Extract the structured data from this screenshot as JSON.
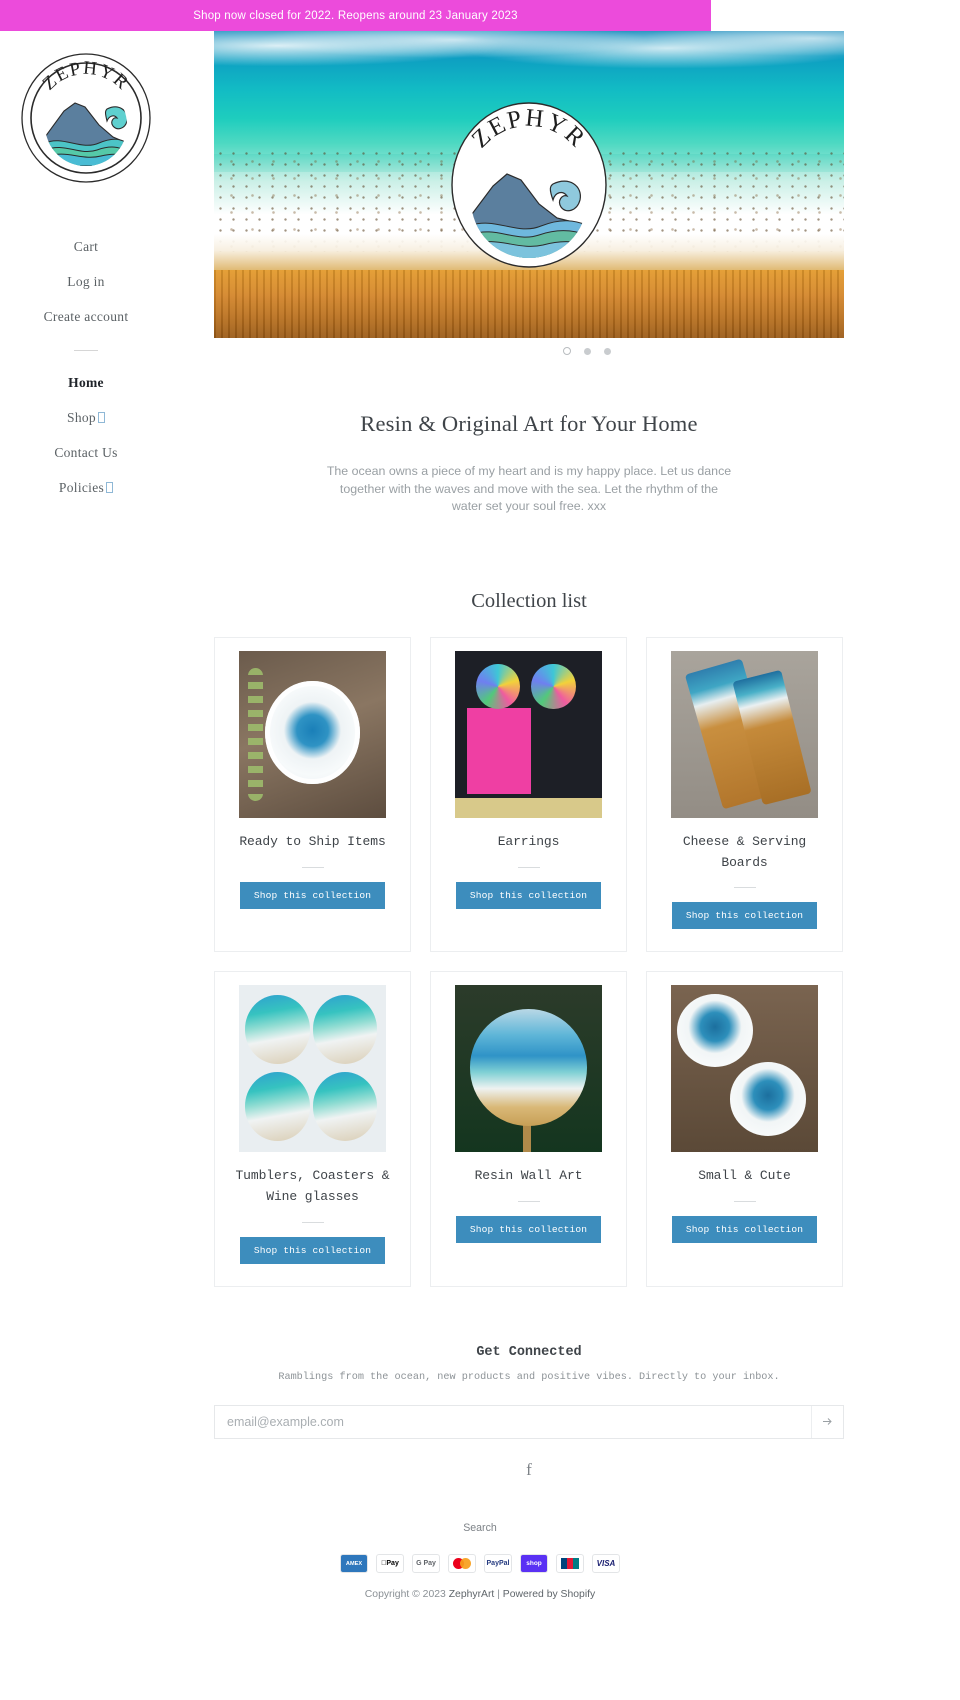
{
  "announcement": {
    "text": "Shop now closed for 2022. Reopens around 23 January 2023",
    "background": "#ec4bdb",
    "color": "#ffffff"
  },
  "brand": {
    "name": "ZEPHYR",
    "logo_alt": "Zephyr circular logo with mountain and waves"
  },
  "sidebar": {
    "account_links": [
      {
        "label": "Cart"
      },
      {
        "label": "Log in"
      },
      {
        "label": "Create account"
      }
    ],
    "main_links": [
      {
        "label": "Home",
        "active": true,
        "has_caret": false
      },
      {
        "label": "Shop",
        "active": false,
        "has_caret": true
      },
      {
        "label": "Contact Us",
        "active": false,
        "has_caret": false
      },
      {
        "label": "Policies",
        "active": false,
        "has_caret": true
      }
    ]
  },
  "hero": {
    "slides_count": 3,
    "active_slide": 1,
    "image_alt": "Resin ocean art with teal water, white foam and wood grain"
  },
  "richtext": {
    "heading": "Resin & Original Art for Your Home",
    "body": "The ocean owns a piece of my heart and is my happy place. Let us dance together with the waves and move with the sea. Let the rhythm of the water set your soul free. xxx"
  },
  "collection_list": {
    "title": "Collection list",
    "button_label": "Shop this collection",
    "button_color": "#3d8dbd",
    "items": [
      {
        "title": "Ready to Ship Items",
        "art": "a-shell"
      },
      {
        "title": "Earrings",
        "art": "a-ear"
      },
      {
        "title": "Cheese & Serving Boards",
        "art": "a-board"
      },
      {
        "title": "Tumblers, Coasters & Wine glasses",
        "art": "a-coast"
      },
      {
        "title": "Resin Wall Art",
        "art": "a-wall"
      },
      {
        "title": "Small & Cute",
        "art": "a-small"
      }
    ]
  },
  "newsletter": {
    "heading": "Get Connected",
    "subheading": "Ramblings from the ocean, new products and positive vibes. Directly to your inbox.",
    "placeholder": "email@example.com",
    "value": "",
    "submit_icon": "arrow-right-icon"
  },
  "social": {
    "facebook_glyph": "f",
    "facebook_label": "Facebook"
  },
  "footer": {
    "search_label": "Search",
    "payment_methods": [
      {
        "name": "American Express",
        "short": "AMEX"
      },
      {
        "name": "Apple Pay",
        "short": "Pay"
      },
      {
        "name": "Google Pay",
        "short": "G Pay"
      },
      {
        "name": "Mastercard",
        "short": ""
      },
      {
        "name": "PayPal",
        "short": "PayPal"
      },
      {
        "name": "Shop Pay",
        "short": "shop"
      },
      {
        "name": "Union Pay",
        "short": ""
      },
      {
        "name": "Visa",
        "short": "VISA"
      }
    ],
    "copyright_prefix": "Copyright © 2023",
    "store_name": "ZephyrArt",
    "separator": "|",
    "powered_by": "Powered by Shopify"
  }
}
